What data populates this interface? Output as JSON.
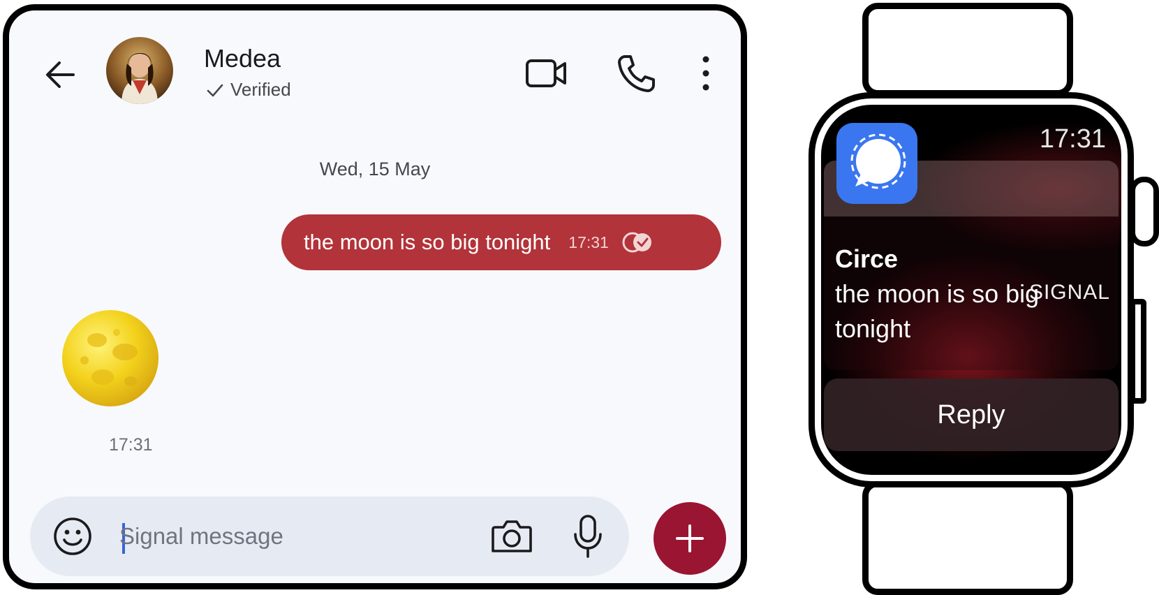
{
  "conversation": {
    "contact_name": "Medea",
    "verified_label": "Verified",
    "date_separator": "Wed, 15 May",
    "outgoing_message": {
      "text": "the moon is so big tonight",
      "time": "17:31",
      "status_icon": "read-receipt-icon"
    },
    "incoming_sticker": {
      "icon": "full-moon-sticker",
      "time": "17:31"
    },
    "composer": {
      "placeholder": "Signal message"
    },
    "header_icons": [
      "back-arrow-icon",
      "avatar",
      "video-call-icon",
      "phone-icon",
      "more-options-icon"
    ],
    "composer_icons": [
      "emoji-icon",
      "camera-icon",
      "microphone-icon",
      "plus-icon"
    ],
    "colors": {
      "outgoing_bubble": "#b23339",
      "send_button": "#9a1532",
      "composer_bg": "#e6ebf3",
      "background": "#f8f9fd"
    }
  },
  "watch": {
    "time": "17:31",
    "app_name": "SIGNAL",
    "app_icon": "signal-app-icon",
    "sender": "Circe",
    "message": "the moon is so big tonight",
    "reply_label": "Reply",
    "colors": {
      "app_icon_bg": "#3a76f0"
    }
  }
}
